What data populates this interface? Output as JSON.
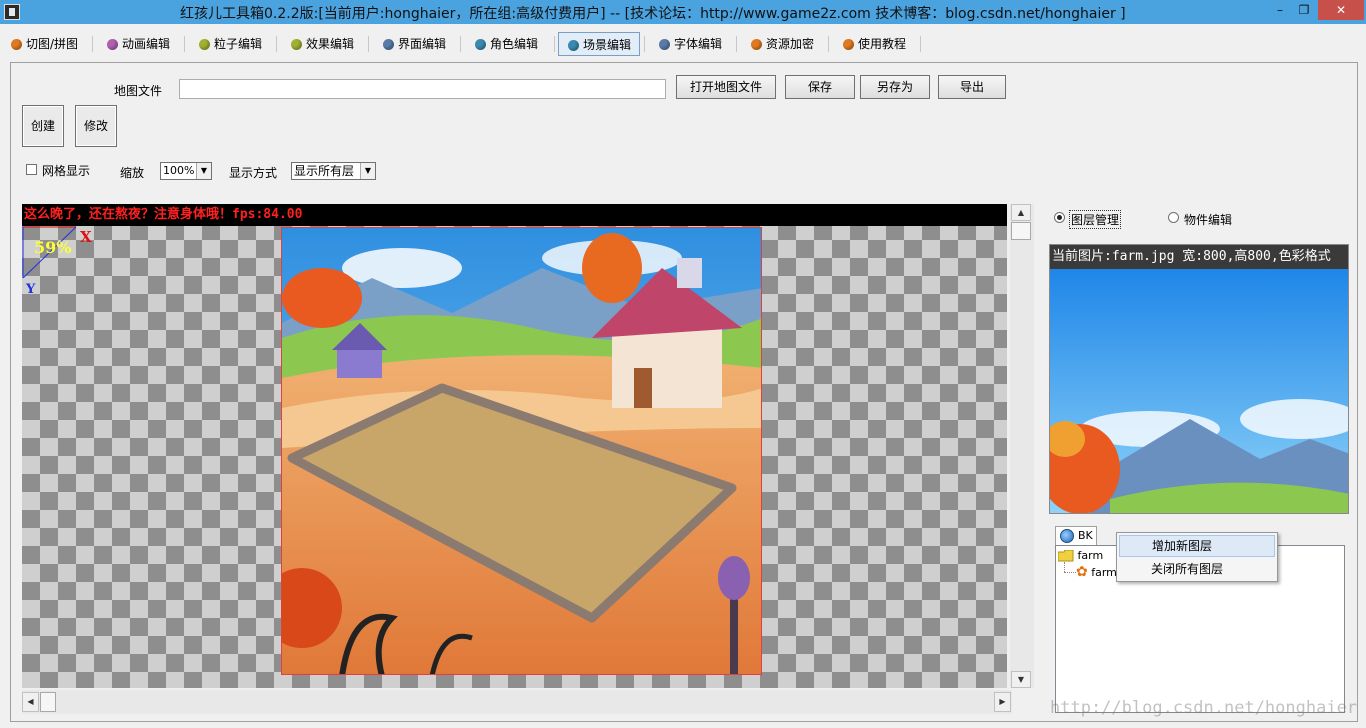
{
  "window": {
    "title": "红孩儿工具箱0.2.2版:[当前用户:honghaier，所在组:高级付费用户]  --  [技术论坛：http://www.game2z.com 技术博客：blog.csdn.net/honghaier ]",
    "minimize": "–",
    "maximize": "❐",
    "close": "✕"
  },
  "toolbar": {
    "items": [
      {
        "label": "切图/拼图",
        "color": "#e07a20"
      },
      {
        "label": "动画编辑",
        "color": "#b060b0"
      },
      {
        "label": "粒子编辑",
        "color": "#a0b030"
      },
      {
        "label": "效果编辑",
        "color": "#a0b030"
      },
      {
        "label": "界面编辑",
        "color": "#5a7aa8"
      },
      {
        "label": "角色编辑",
        "color": "#3a8ab0"
      },
      {
        "label": "场景编辑",
        "color": "#3a8ab0"
      },
      {
        "label": "字体编辑",
        "color": "#5a7aa8"
      },
      {
        "label": "资源加密",
        "color": "#e07a20"
      },
      {
        "label": "使用教程",
        "color": "#e07a20"
      }
    ],
    "active_index": 6
  },
  "map_file": {
    "label": "地图文件",
    "value": "",
    "open_label": "打开地图文件",
    "save_label": "保存",
    "save_as_label": "另存为",
    "export_label": "导出"
  },
  "actions": {
    "create_label": "创建",
    "modify_label": "修改"
  },
  "view_options": {
    "grid_label": "网格显示",
    "grid_checked": false,
    "zoom_label": "缩放",
    "zoom_value": "100%",
    "display_mode_label": "显示方式",
    "display_mode_value": "显示所有层"
  },
  "canvas": {
    "status_text": "这么晚了，还在熬夜？注意身体哦！fps:84.00",
    "zoom_indicator": "59%",
    "axis_x": "X",
    "axis_y": "Y"
  },
  "right_panel": {
    "mode_layer_label": "图层管理",
    "mode_object_label": "物件编辑",
    "selected_mode": "layer",
    "preview_info": "当前图片:farm.jpg 宽:800,高800,色彩格式",
    "tab_label": "BK",
    "tree": {
      "folder_label": "farm",
      "child_label": "farm"
    }
  },
  "context_menu": {
    "items": [
      "增加新图层",
      "关闭所有图层"
    ],
    "hover_index": 0
  },
  "watermark": "http://blog.csdn.net/honghaier"
}
